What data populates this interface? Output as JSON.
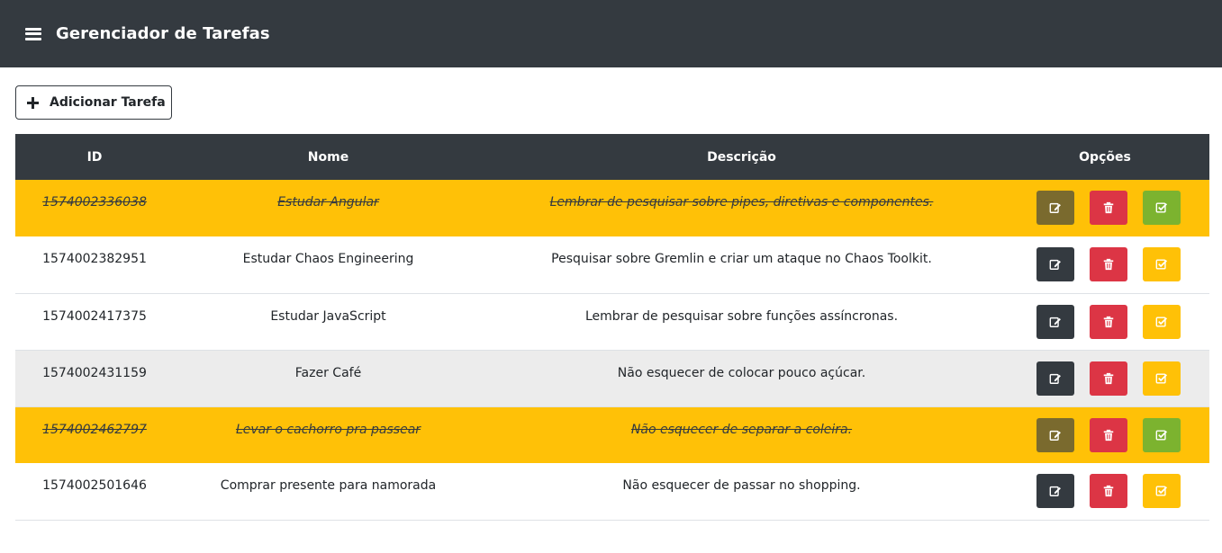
{
  "app": {
    "title": "Gerenciador de Tarefas",
    "menu_icon": "bars-icon"
  },
  "toolbar": {
    "add_label": "Adicionar Tarefa",
    "add_icon": "plus-icon"
  },
  "table": {
    "headers": {
      "id": "ID",
      "nome": "Nome",
      "descricao": "Descrição",
      "opcoes": "Opções"
    },
    "rows": [
      {
        "id": "1574002336038",
        "nome": "Estudar Angular",
        "descricao": "Lembrar de pesquisar sobre pipes, diretivas e componentes.",
        "concluida": true
      },
      {
        "id": "1574002382951",
        "nome": "Estudar Chaos Engineering",
        "descricao": "Pesquisar sobre Gremlin e criar um ataque no Chaos Toolkit.",
        "concluida": false
      },
      {
        "id": "1574002417375",
        "nome": "Estudar JavaScript",
        "descricao": "Lembrar de pesquisar sobre funções assíncronas.",
        "concluida": false
      },
      {
        "id": "1574002431159",
        "nome": "Fazer Café",
        "descricao": "Não esquecer de colocar pouco açúcar.",
        "concluida": false
      },
      {
        "id": "1574002462797",
        "nome": "Levar o cachorro pra passear",
        "descricao": "Não esquecer de separar a coleira.",
        "concluida": true
      },
      {
        "id": "1574002501646",
        "nome": "Comprar presente para namorada",
        "descricao": "Não esquecer de passar no shopping.",
        "concluida": false
      }
    ]
  },
  "colors": {
    "navbar": "#343a40",
    "done_row": "#ffc107",
    "edit_button": "#343a40",
    "delete_button": "#dc3545",
    "check_button": "#ffc107",
    "done_check_button": "#7cb32f"
  }
}
